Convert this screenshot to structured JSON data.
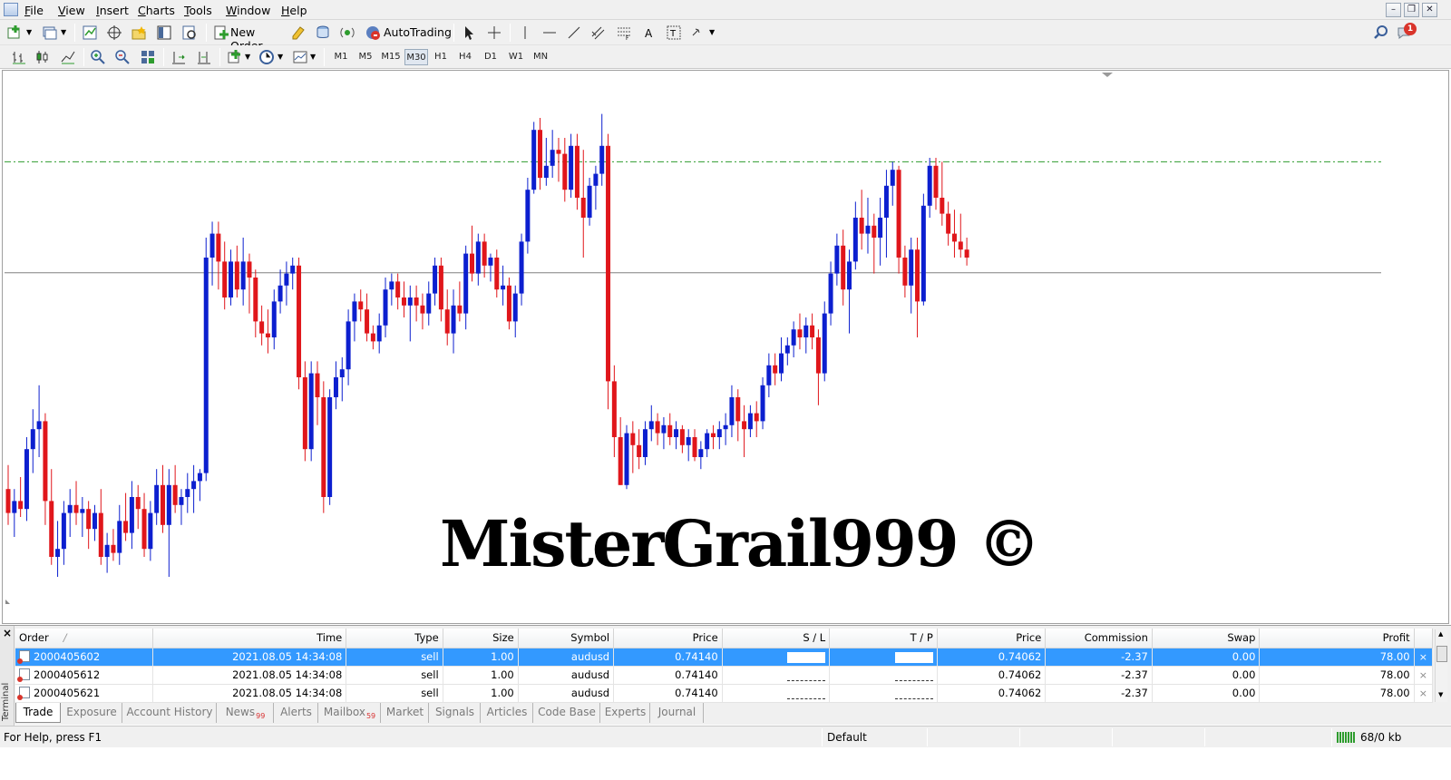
{
  "menu": {
    "items": [
      "File",
      "View",
      "Insert",
      "Charts",
      "Tools",
      "Window",
      "Help"
    ]
  },
  "window_controls": {
    "minimize": "–",
    "restore": "❐",
    "close": "✕"
  },
  "toolbar": {
    "new_order": "New Order",
    "autotrading": "AutoTrading",
    "alert_count": "1",
    "timeframes": [
      "M1",
      "M5",
      "M15",
      "M30",
      "H1",
      "H4",
      "D1",
      "W1",
      "MN"
    ],
    "active_timeframe": "M30"
  },
  "chart": {
    "watermark": "MisterGrail999 ©",
    "colors": {
      "bull": "#0c1fcf",
      "bear": "#e0161b",
      "level": "#2e9c2e",
      "price_line": "#808080"
    },
    "levels": {
      "bid_price": 0.74062,
      "dashed_level": 0.7434
    },
    "candles": [
      [
        0.7352,
        0.7358,
        0.7343,
        0.7346
      ],
      [
        0.7346,
        0.7352,
        0.734,
        0.7349
      ],
      [
        0.7349,
        0.7355,
        0.7345,
        0.7347
      ],
      [
        0.7347,
        0.7365,
        0.7344,
        0.7362
      ],
      [
        0.7362,
        0.7372,
        0.7356,
        0.7367
      ],
      [
        0.7367,
        0.7378,
        0.736,
        0.7369
      ],
      [
        0.7369,
        0.7371,
        0.7343,
        0.7349
      ],
      [
        0.7349,
        0.7357,
        0.7333,
        0.7335
      ],
      [
        0.7335,
        0.7344,
        0.733,
        0.7337
      ],
      [
        0.7337,
        0.7349,
        0.7333,
        0.7346
      ],
      [
        0.7346,
        0.7352,
        0.734,
        0.7348
      ],
      [
        0.7348,
        0.7354,
        0.7343,
        0.7346
      ],
      [
        0.7346,
        0.735,
        0.734,
        0.7347
      ],
      [
        0.7347,
        0.7349,
        0.7337,
        0.7342
      ],
      [
        0.7342,
        0.7348,
        0.7339,
        0.7346
      ],
      [
        0.7346,
        0.7352,
        0.7333,
        0.7335
      ],
      [
        0.7335,
        0.7341,
        0.7331,
        0.7338
      ],
      [
        0.7338,
        0.7342,
        0.7334,
        0.7336
      ],
      [
        0.7336,
        0.7348,
        0.7333,
        0.7344
      ],
      [
        0.7344,
        0.7351,
        0.7339,
        0.7341
      ],
      [
        0.7341,
        0.7354,
        0.7337,
        0.735
      ],
      [
        0.735,
        0.7353,
        0.7342,
        0.7347
      ],
      [
        0.7347,
        0.7351,
        0.7335,
        0.7337
      ],
      [
        0.7337,
        0.7349,
        0.7334,
        0.7346
      ],
      [
        0.7346,
        0.7357,
        0.7343,
        0.7353
      ],
      [
        0.7353,
        0.7358,
        0.7341,
        0.7343
      ],
      [
        0.7343,
        0.7357,
        0.733,
        0.7353
      ],
      [
        0.7353,
        0.7358,
        0.7346,
        0.7348
      ],
      [
        0.7348,
        0.7352,
        0.7343,
        0.735
      ],
      [
        0.735,
        0.7356,
        0.7346,
        0.7352
      ],
      [
        0.7352,
        0.7358,
        0.7346,
        0.7354
      ],
      [
        0.7354,
        0.7357,
        0.7349,
        0.7356
      ],
      [
        0.7356,
        0.7415,
        0.7354,
        0.741
      ],
      [
        0.741,
        0.7419,
        0.7403,
        0.7416
      ],
      [
        0.7416,
        0.7419,
        0.7402,
        0.7409
      ],
      [
        0.7409,
        0.7414,
        0.7397,
        0.74
      ],
      [
        0.74,
        0.7412,
        0.7398,
        0.7409
      ],
      [
        0.7409,
        0.7413,
        0.74,
        0.7402
      ],
      [
        0.7402,
        0.7415,
        0.7398,
        0.7409
      ],
      [
        0.7409,
        0.7411,
        0.7396,
        0.7405
      ],
      [
        0.7405,
        0.7407,
        0.739,
        0.7394
      ],
      [
        0.7394,
        0.7398,
        0.7388,
        0.7391
      ],
      [
        0.7391,
        0.7397,
        0.7386,
        0.739
      ],
      [
        0.739,
        0.7402,
        0.7387,
        0.7399
      ],
      [
        0.7399,
        0.7407,
        0.7396,
        0.7403
      ],
      [
        0.7403,
        0.7409,
        0.7398,
        0.7406
      ],
      [
        0.7406,
        0.741,
        0.7402,
        0.7408
      ],
      [
        0.7408,
        0.741,
        0.7377,
        0.738
      ],
      [
        0.738,
        0.7384,
        0.7359,
        0.7362
      ],
      [
        0.7362,
        0.7384,
        0.7359,
        0.7381
      ],
      [
        0.7381,
        0.7384,
        0.7368,
        0.7375
      ],
      [
        0.7375,
        0.7379,
        0.7346,
        0.735
      ],
      [
        0.735,
        0.7377,
        0.7348,
        0.7375
      ],
      [
        0.7375,
        0.7384,
        0.7372,
        0.738
      ],
      [
        0.738,
        0.7385,
        0.7374,
        0.7382
      ],
      [
        0.7382,
        0.7397,
        0.7378,
        0.7394
      ],
      [
        0.7394,
        0.7401,
        0.7389,
        0.7399
      ],
      [
        0.7399,
        0.7402,
        0.7394,
        0.7397
      ],
      [
        0.7397,
        0.7401,
        0.7389,
        0.7391
      ],
      [
        0.7391,
        0.7393,
        0.7387,
        0.7389
      ],
      [
        0.7389,
        0.7396,
        0.7386,
        0.7393
      ],
      [
        0.7393,
        0.7405,
        0.739,
        0.7402
      ],
      [
        0.7402,
        0.7406,
        0.7398,
        0.7404
      ],
      [
        0.7404,
        0.7406,
        0.7397,
        0.74
      ],
      [
        0.74,
        0.7404,
        0.7395,
        0.7398
      ],
      [
        0.7398,
        0.7403,
        0.7389,
        0.74
      ],
      [
        0.74,
        0.7403,
        0.7394,
        0.7398
      ],
      [
        0.7398,
        0.7401,
        0.7392,
        0.7396
      ],
      [
        0.7396,
        0.7404,
        0.7393,
        0.7401
      ],
      [
        0.7401,
        0.741,
        0.7398,
        0.7408
      ],
      [
        0.7408,
        0.741,
        0.7394,
        0.7397
      ],
      [
        0.7397,
        0.7402,
        0.7388,
        0.7391
      ],
      [
        0.7391,
        0.7402,
        0.7386,
        0.7398
      ],
      [
        0.7398,
        0.7404,
        0.7394,
        0.7396
      ],
      [
        0.7396,
        0.7413,
        0.7392,
        0.7411
      ],
      [
        0.7411,
        0.7418,
        0.7404,
        0.7406
      ],
      [
        0.7406,
        0.7416,
        0.7403,
        0.7414
      ],
      [
        0.7414,
        0.7416,
        0.7405,
        0.7408
      ],
      [
        0.7408,
        0.7411,
        0.7404,
        0.741
      ],
      [
        0.741,
        0.7412,
        0.74,
        0.7402
      ],
      [
        0.7402,
        0.7408,
        0.7398,
        0.7403
      ],
      [
        0.7403,
        0.7405,
        0.7392,
        0.7394
      ],
      [
        0.7394,
        0.7403,
        0.739,
        0.7401
      ],
      [
        0.7401,
        0.7416,
        0.7398,
        0.7414
      ],
      [
        0.7414,
        0.743,
        0.7411,
        0.7427
      ],
      [
        0.7427,
        0.7444,
        0.7426,
        0.7442
      ],
      [
        0.7442,
        0.7445,
        0.7427,
        0.743
      ],
      [
        0.743,
        0.744,
        0.7428,
        0.7433
      ],
      [
        0.7433,
        0.7442,
        0.743,
        0.7437
      ],
      [
        0.7437,
        0.744,
        0.7429,
        0.7436
      ],
      [
        0.7436,
        0.744,
        0.7424,
        0.7427
      ],
      [
        0.7427,
        0.7441,
        0.7425,
        0.7438
      ],
      [
        0.7438,
        0.7441,
        0.7422,
        0.7425
      ],
      [
        0.7425,
        0.7437,
        0.741,
        0.742
      ],
      [
        0.742,
        0.743,
        0.7418,
        0.7428
      ],
      [
        0.7428,
        0.7433,
        0.7422,
        0.7431
      ],
      [
        0.7431,
        0.7446,
        0.7428,
        0.7438
      ],
      [
        0.7438,
        0.7441,
        0.7372,
        0.7379
      ],
      [
        0.7379,
        0.7383,
        0.736,
        0.7365
      ],
      [
        0.7365,
        0.737,
        0.7353,
        0.7353
      ],
      [
        0.7353,
        0.7368,
        0.7352,
        0.7366
      ],
      [
        0.7366,
        0.7369,
        0.7356,
        0.7363
      ],
      [
        0.7363,
        0.7367,
        0.7357,
        0.736
      ],
      [
        0.736,
        0.7369,
        0.7358,
        0.7367
      ],
      [
        0.7367,
        0.7373,
        0.7364,
        0.7369
      ],
      [
        0.7369,
        0.7371,
        0.7363,
        0.7366
      ],
      [
        0.7366,
        0.737,
        0.7362,
        0.7368
      ],
      [
        0.7368,
        0.7371,
        0.7363,
        0.7365
      ],
      [
        0.7365,
        0.7369,
        0.7362,
        0.7367
      ],
      [
        0.7367,
        0.7368,
        0.7361,
        0.7363
      ],
      [
        0.7363,
        0.7367,
        0.7359,
        0.7365
      ],
      [
        0.7365,
        0.7367,
        0.7359,
        0.736
      ],
      [
        0.736,
        0.7364,
        0.7357,
        0.7362
      ],
      [
        0.7362,
        0.7367,
        0.736,
        0.7366
      ],
      [
        0.7366,
        0.7368,
        0.7362,
        0.7365
      ],
      [
        0.7365,
        0.7369,
        0.7362,
        0.7367
      ],
      [
        0.7367,
        0.7371,
        0.7363,
        0.7368
      ],
      [
        0.7368,
        0.7378,
        0.7365,
        0.7375
      ],
      [
        0.7375,
        0.7377,
        0.7364,
        0.7369
      ],
      [
        0.7369,
        0.7373,
        0.736,
        0.7367
      ],
      [
        0.7367,
        0.7373,
        0.7365,
        0.7371
      ],
      [
        0.7371,
        0.7374,
        0.7365,
        0.7369
      ],
      [
        0.7369,
        0.738,
        0.7367,
        0.7378
      ],
      [
        0.7378,
        0.7386,
        0.7375,
        0.7383
      ],
      [
        0.7383,
        0.7386,
        0.7378,
        0.7381
      ],
      [
        0.7381,
        0.739,
        0.7379,
        0.7386
      ],
      [
        0.7386,
        0.739,
        0.7383,
        0.7388
      ],
      [
        0.7388,
        0.7394,
        0.7385,
        0.7392
      ],
      [
        0.7392,
        0.7396,
        0.7387,
        0.739
      ],
      [
        0.739,
        0.7395,
        0.7386,
        0.7393
      ],
      [
        0.7393,
        0.7396,
        0.7387,
        0.739
      ],
      [
        0.739,
        0.7392,
        0.7373,
        0.7381
      ],
      [
        0.7381,
        0.7399,
        0.7379,
        0.7396
      ],
      [
        0.7396,
        0.7409,
        0.7393,
        0.7406
      ],
      [
        0.7406,
        0.7416,
        0.7403,
        0.7413
      ],
      [
        0.7413,
        0.7417,
        0.7398,
        0.7402
      ],
      [
        0.7402,
        0.7412,
        0.7391,
        0.7409
      ],
      [
        0.7409,
        0.7424,
        0.7407,
        0.742
      ],
      [
        0.742,
        0.7427,
        0.7412,
        0.7416
      ],
      [
        0.7416,
        0.7425,
        0.7411,
        0.7418
      ],
      [
        0.7418,
        0.7421,
        0.7406,
        0.7415
      ],
      [
        0.7415,
        0.7425,
        0.7408,
        0.742
      ],
      [
        0.742,
        0.7432,
        0.741,
        0.7428
      ],
      [
        0.7428,
        0.7434,
        0.7423,
        0.7432
      ],
      [
        0.7432,
        0.7433,
        0.7406,
        0.741
      ],
      [
        0.741,
        0.7413,
        0.74,
        0.7403
      ],
      [
        0.7403,
        0.7415,
        0.7396,
        0.7412
      ],
      [
        0.7412,
        0.7415,
        0.739,
        0.7399
      ],
      [
        0.7399,
        0.7426,
        0.7398,
        0.7423
      ],
      [
        0.7423,
        0.7435,
        0.742,
        0.7433
      ],
      [
        0.7433,
        0.7435,
        0.7422,
        0.7425
      ],
      [
        0.7425,
        0.7434,
        0.7418,
        0.7421
      ],
      [
        0.7421,
        0.7424,
        0.7413,
        0.7416
      ],
      [
        0.7416,
        0.7422,
        0.741,
        0.7414
      ],
      [
        0.7414,
        0.7421,
        0.741,
        0.7412
      ],
      [
        0.7412,
        0.7415,
        0.7408,
        0.741
      ]
    ]
  },
  "terminal": {
    "side_label": "Terminal",
    "close": "×",
    "columns": [
      "Order",
      "Time",
      "Type",
      "Size",
      "Symbol",
      "Price",
      "S / L",
      "T / P",
      "Price",
      "Commission",
      "Swap",
      "Profit"
    ],
    "sort_indicator": "/",
    "rows": [
      {
        "order": "2000405602",
        "time": "2021.08.05 14:34:08",
        "type": "sell",
        "size": "1.00",
        "symbol": "audusd",
        "price": "0.74140",
        "sl": "",
        "tp": "",
        "price2": "0.74062",
        "commission": "-2.37",
        "swap": "0.00",
        "profit": "78.00"
      },
      {
        "order": "2000405612",
        "time": "2021.08.05 14:34:08",
        "type": "sell",
        "size": "1.00",
        "symbol": "audusd",
        "price": "0.74140",
        "sl": "",
        "tp": "",
        "price2": "0.74062",
        "commission": "-2.37",
        "swap": "0.00",
        "profit": "78.00"
      },
      {
        "order": "2000405621",
        "time": "2021.08.05 14:34:08",
        "type": "sell",
        "size": "1.00",
        "symbol": "audusd",
        "price": "0.74140",
        "sl": "",
        "tp": "",
        "price2": "0.74062",
        "commission": "-2.37",
        "swap": "0.00",
        "profit": "78.00"
      }
    ],
    "row_close": "×",
    "tabs": [
      "Trade",
      "Exposure",
      "Account History",
      "News",
      "Alerts",
      "Mailbox",
      "Market",
      "Signals",
      "Articles",
      "Code Base",
      "Experts",
      "Journal"
    ],
    "news_count": "99",
    "mailbox_count": "59"
  },
  "status": {
    "help": "For Help, press F1",
    "profile": "Default",
    "traffic": "68/0 kb"
  }
}
